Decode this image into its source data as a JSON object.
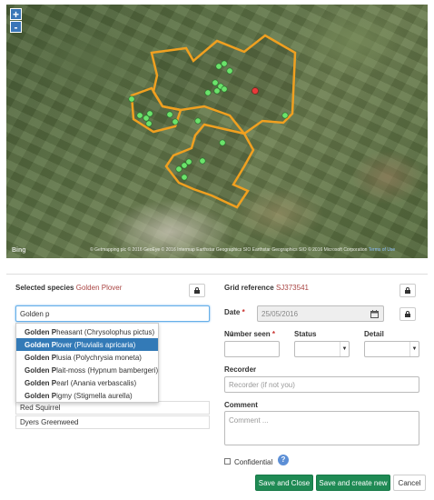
{
  "map": {
    "zoom_in": "+",
    "zoom_out": "-",
    "logo": "Bing",
    "attribution": "© Getmapping plc © 2016 GeoEye © 2016 Intermap Earthstar Geographics SIO Earthstar Geographics SIO © 2016 Microsoft Corporation",
    "attribution_link": "Terms of Use",
    "colors": {
      "boundary": "#f0a020",
      "record_point": "#6be36b",
      "selected_point": "#e83a3a"
    }
  },
  "species": {
    "label": "Selected species",
    "selected": "Golden Plover",
    "search_value": "Golden p",
    "list": [
      "Red Squirrel",
      "Dyers Greenweed"
    ],
    "sort_icon": "sort-arrows-icon",
    "suggestions": [
      {
        "name": "Golden Pheasant",
        "latin": "(Chrysolophus pictus)"
      },
      {
        "name": "Golden Plover",
        "latin": "(Pluvialis apricaria)",
        "active": true
      },
      {
        "name": "Golden Plusia",
        "latin": "(Polychrysia moneta)"
      },
      {
        "name": "Golden Plait-moss",
        "latin": "(Hypnum bambergeri)"
      },
      {
        "name": "Golden Pearl",
        "latin": "(Anania verbascalis)"
      },
      {
        "name": "Golden Pigmy",
        "latin": "(Stigmella aurella)"
      }
    ]
  },
  "grid": {
    "label": "Grid reference",
    "value": "SJ373541"
  },
  "date": {
    "label": "Date",
    "value": "25/05/2016"
  },
  "number_seen": {
    "label": "Number seen",
    "value": ""
  },
  "status": {
    "label": "Status",
    "value": ""
  },
  "detail": {
    "label": "Detail",
    "value": ""
  },
  "recorder": {
    "label": "Recorder",
    "placeholder": "Recorder (if not you)"
  },
  "comment": {
    "label": "Comment",
    "placeholder": "Comment ..."
  },
  "confidential": {
    "label": "Confidential",
    "checked": false
  },
  "buttons": {
    "save_close": "Save and Close",
    "save_new": "Save and create new",
    "cancel": "Cancel"
  }
}
